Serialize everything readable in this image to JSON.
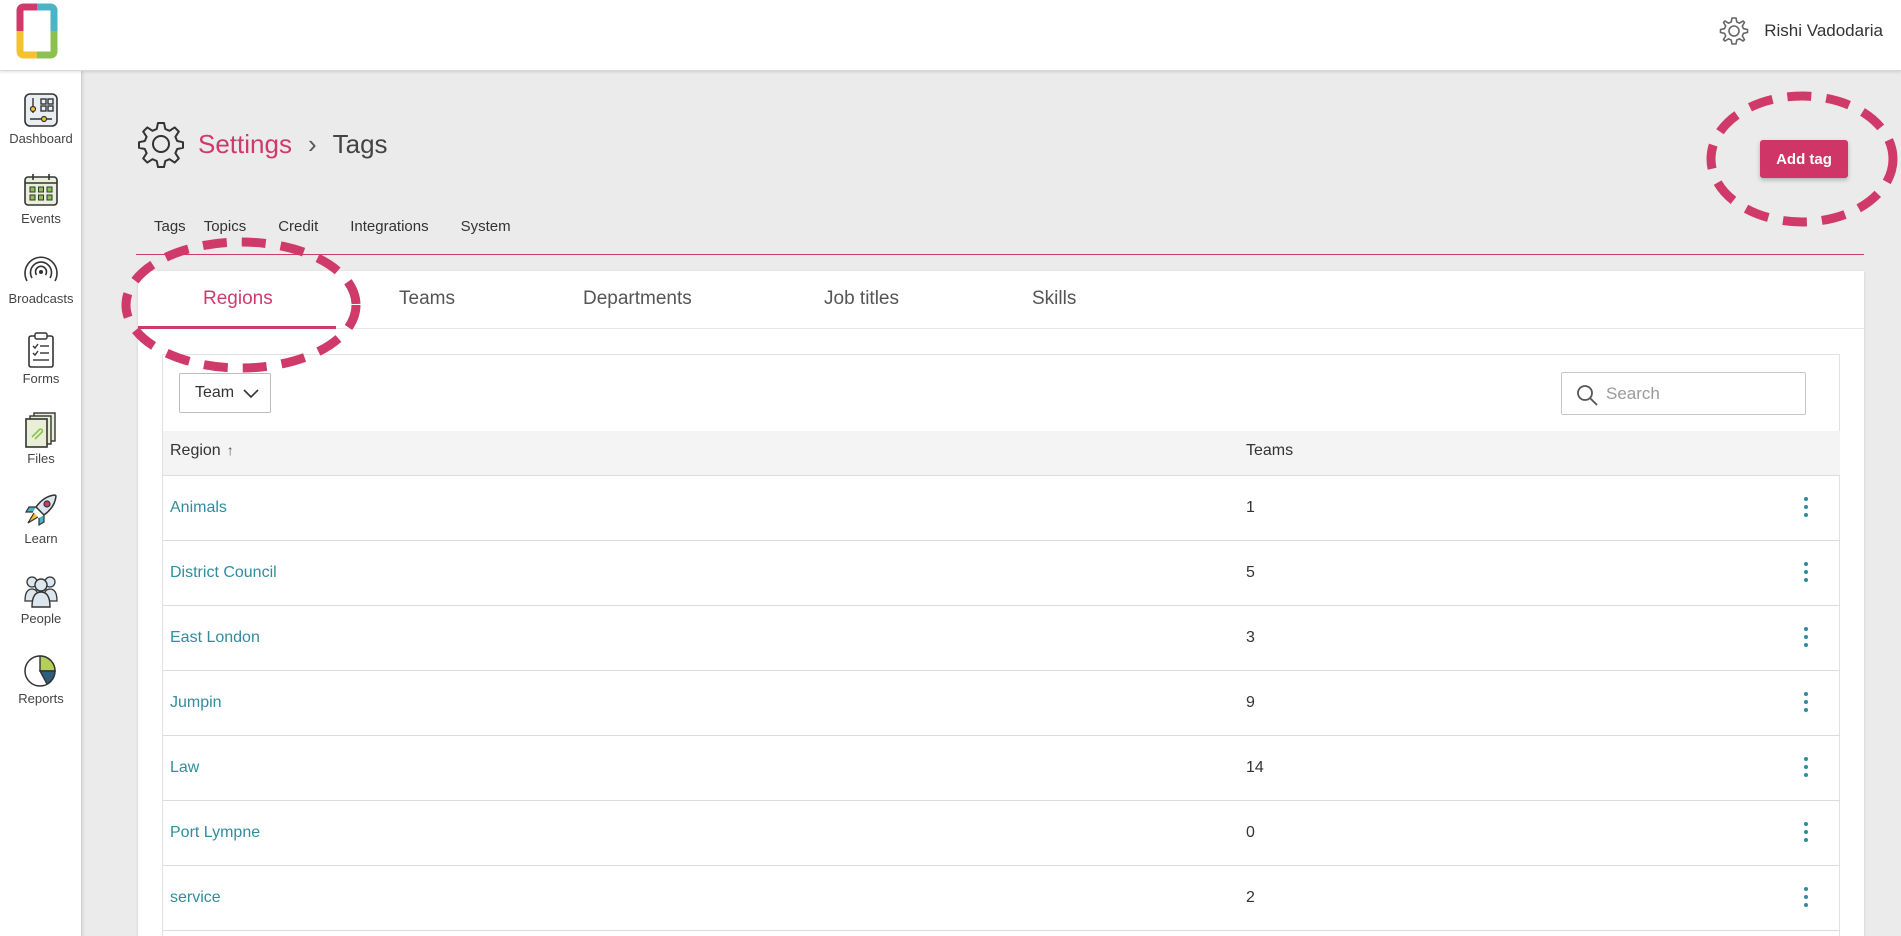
{
  "app": {
    "logo_name": "app-logo",
    "user_name": "Rishi Vadodaria"
  },
  "colors": {
    "accent": "#d03a6b",
    "link": "#2f8d9e"
  },
  "sidebar": {
    "items": [
      {
        "label": "Dashboard",
        "icon": "dashboard-icon"
      },
      {
        "label": "Events",
        "icon": "calendar-icon"
      },
      {
        "label": "Broadcasts",
        "icon": "broadcast-icon"
      },
      {
        "label": "Forms",
        "icon": "clipboard-icon"
      },
      {
        "label": "Files",
        "icon": "files-icon"
      },
      {
        "label": "Learn",
        "icon": "rocket-icon"
      },
      {
        "label": "People",
        "icon": "people-icon"
      },
      {
        "label": "Reports",
        "icon": "pie-chart-icon"
      }
    ]
  },
  "header": {
    "breadcrumb_root": "Settings",
    "breadcrumb_sep": "›",
    "breadcrumb_current": "Tags",
    "add_button": "Add tag"
  },
  "settings_tabs": [
    "Tags",
    "Topics",
    "Credit",
    "Integrations",
    "System"
  ],
  "sub_tabs": {
    "items": [
      "Regions",
      "Teams",
      "Departments",
      "Job titles",
      "Skills"
    ],
    "active": "Regions"
  },
  "filters": {
    "dropdown_value": "Team",
    "search_placeholder": "Search"
  },
  "table": {
    "columns": [
      "Region",
      "Teams"
    ],
    "sort_indicator": "↑",
    "rows": [
      {
        "name": "Animals",
        "teams": "1"
      },
      {
        "name": "District Council",
        "teams": "5"
      },
      {
        "name": "East London",
        "teams": "3"
      },
      {
        "name": "Jumpin",
        "teams": "9"
      },
      {
        "name": "Law",
        "teams": "14"
      },
      {
        "name": "Port Lympne",
        "teams": "0"
      },
      {
        "name": "service",
        "teams": "2"
      }
    ]
  }
}
